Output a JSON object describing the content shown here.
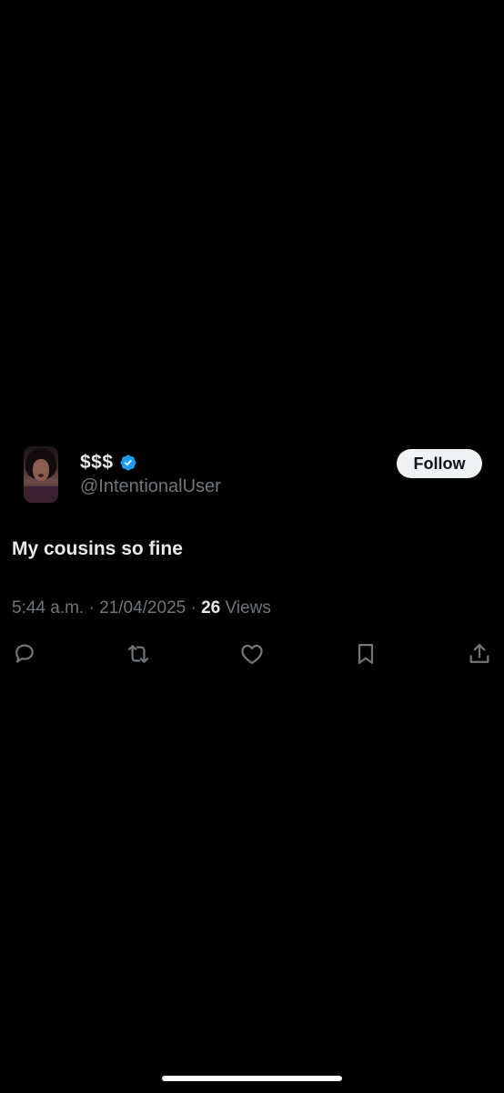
{
  "tweet": {
    "display_name": "$$$",
    "handle": "@IntentionalUser",
    "verified": true,
    "follow_label": "Follow",
    "text": "My cousins so fine",
    "time": "5:44 a.m.",
    "date": "21/04/2025",
    "separator": "·",
    "views_count": "26",
    "views_label": "Views"
  },
  "actions": [
    {
      "name": "reply-icon"
    },
    {
      "name": "retweet-icon"
    },
    {
      "name": "like-icon"
    },
    {
      "name": "bookmark-icon"
    },
    {
      "name": "share-icon"
    }
  ],
  "colors": {
    "background": "#000000",
    "primary_text": "#e7e9ea",
    "secondary_text": "#71767b",
    "verified_blue": "#1d9bf0",
    "follow_bg": "#eff3f4"
  }
}
